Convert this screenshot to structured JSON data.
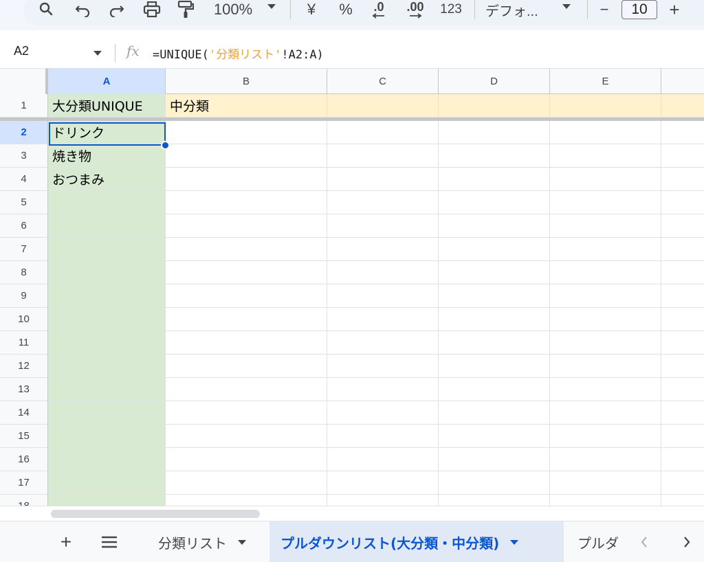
{
  "toolbar": {
    "zoom": "100%",
    "currency": "¥",
    "percent": "%",
    "decrease_decimal": ".0",
    "increase_decimal": ".00",
    "number_format": "123",
    "font_name": "デフォ...",
    "font_size": "10",
    "minus": "−",
    "plus": "+"
  },
  "formula_bar": {
    "cell_ref": "A2",
    "fx": "fx",
    "formula_prefix": "=UNIQUE(",
    "formula_string": "'分類リスト'",
    "formula_suffix": "!A2:A)"
  },
  "columns": [
    "A",
    "B",
    "C",
    "D",
    "E"
  ],
  "rows": [
    {
      "num": "1",
      "a": "大分類UNIQUE",
      "b": "中分類"
    },
    {
      "num": "2",
      "a": "ドリンク",
      "b": ""
    },
    {
      "num": "3",
      "a": "焼き物",
      "b": ""
    },
    {
      "num": "4",
      "a": "おつまみ",
      "b": ""
    },
    {
      "num": "5",
      "a": "",
      "b": ""
    },
    {
      "num": "6",
      "a": "",
      "b": ""
    },
    {
      "num": "7",
      "a": "",
      "b": ""
    },
    {
      "num": "8",
      "a": "",
      "b": ""
    },
    {
      "num": "9",
      "a": "",
      "b": ""
    },
    {
      "num": "10",
      "a": "",
      "b": ""
    },
    {
      "num": "11",
      "a": "",
      "b": ""
    },
    {
      "num": "12",
      "a": "",
      "b": ""
    },
    {
      "num": "13",
      "a": "",
      "b": ""
    },
    {
      "num": "14",
      "a": "",
      "b": ""
    },
    {
      "num": "15",
      "a": "",
      "b": ""
    },
    {
      "num": "16",
      "a": "",
      "b": ""
    },
    {
      "num": "17",
      "a": "",
      "b": ""
    },
    {
      "num": "18",
      "a": "",
      "b": ""
    }
  ],
  "tabs": {
    "add": "+",
    "sheet1": "分類リスト",
    "sheet2": "プルダウンリスト(大分類・中分類)",
    "sheet3": "プルダ"
  },
  "colors": {
    "selection": "#0b57d0",
    "green_fill": "#d9ead3",
    "yellow_fill": "#fff2cc"
  }
}
